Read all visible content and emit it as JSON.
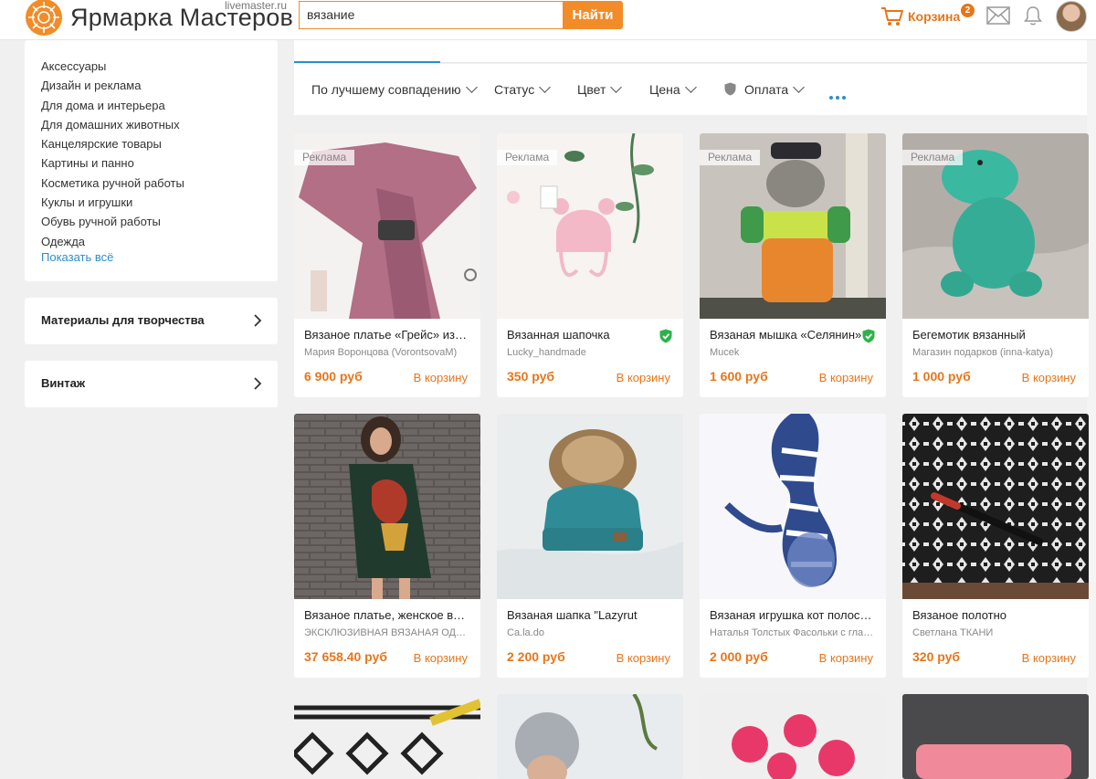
{
  "header": {
    "logo_text": "Ярмарка Мастеров",
    "logo_sub": "livemaster.ru",
    "search_value": "вязание",
    "search_button": "Найти",
    "cart_label": "Корзина",
    "cart_count": "2",
    "accent_color": "#f28c28"
  },
  "sidebar": {
    "categories": [
      "Аксессуары",
      "Дизайн и реклама",
      "Для дома и интерьера",
      "Для домашних животных",
      "Канцелярские товары",
      "Картины и панно",
      "Косметика ручной работы",
      "Куклы и игрушки",
      "Обувь ручной работы",
      "Одежда"
    ],
    "show_all": "Показать всё",
    "sections": [
      "Материалы для творчества",
      "Винтаж"
    ]
  },
  "filters": {
    "sort": "По лучшему совпадению",
    "status": "Статус",
    "color": "Цвет",
    "price": "Цена",
    "payment": "Оплата"
  },
  "products": [
    {
      "title": "Вязаное платье «Грейс» из мериноса",
      "seller": "Мария Воронцова (VorontsovaM)",
      "price": "6 900 руб",
      "cart": "В корзину",
      "ad": "Реклама",
      "verified": false
    },
    {
      "title": "Вязанная шапочка",
      "seller": "Lucky_handmade",
      "price": "350 руб",
      "cart": "В корзину",
      "ad": "Реклама",
      "verified": true
    },
    {
      "title": "Вязаная мышка «Селянин»",
      "seller": "Mucek",
      "price": "1 600 руб",
      "cart": "В корзину",
      "ad": "Реклама",
      "verified": true
    },
    {
      "title": "Бегемотик вязанный",
      "seller": "Магазин подарков (inna-katya)",
      "price": "1 000 руб",
      "cart": "В корзину",
      "ad": "Реклама",
      "verified": false
    },
    {
      "title": "Вязаное платье, женское вязаное платье",
      "seller": "ЭКСКЛЮЗИВНАЯ ВЯЗАНАЯ ОДЕЖДА",
      "price": "37 658.40 руб",
      "cart": "В корзину",
      "ad": "",
      "verified": false
    },
    {
      "title": "Вязаная шапка \"Lazyrut",
      "seller": "Ca.la.do",
      "price": "2 200 руб",
      "cart": "В корзину",
      "ad": "",
      "verified": false
    },
    {
      "title": "Вязаная игрушка кот полосатый",
      "seller": "Наталья Толстых Фасольки с глазками",
      "price": "2 000 руб",
      "cart": "В корзину",
      "ad": "",
      "verified": false
    },
    {
      "title": "Вязаное полотно",
      "seller": "Светлана ТКАНИ",
      "price": "320 руб",
      "cart": "В корзину",
      "ad": "",
      "verified": false
    }
  ]
}
